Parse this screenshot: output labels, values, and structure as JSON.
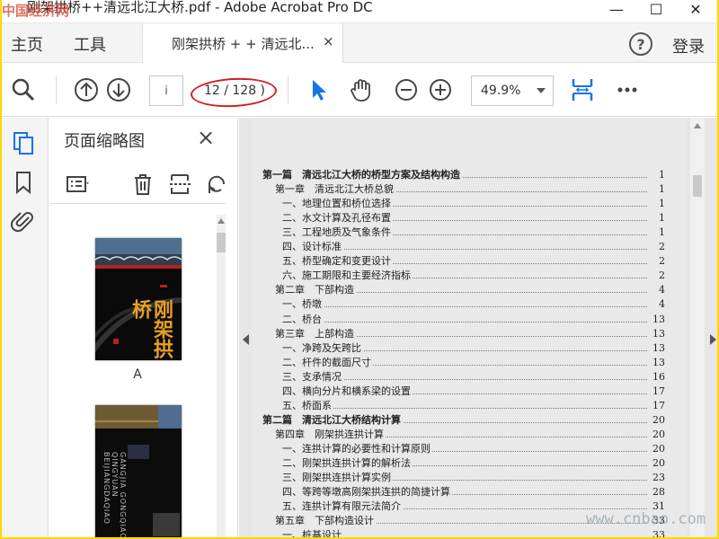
{
  "window": {
    "title": "刚架拱桥++清远北江大桥.pdf - Adobe Acrobat Pro DC",
    "watermark": "中国经济网"
  },
  "menu": {
    "home": "主页",
    "tools": "工具"
  },
  "tab": {
    "label": "刚架拱桥 + + 清远北...",
    "close": "×"
  },
  "header": {
    "help": "?",
    "login": "登录"
  },
  "toolbar": {
    "page_input_value": "i",
    "page_count": "12 / 128 )",
    "zoom_value": "49.9%"
  },
  "thumbnails": {
    "panel_title": "页面缩略图",
    "close": "×",
    "pages": [
      {
        "label": "A",
        "cover_text": "刚架拱桥"
      },
      {
        "label": "",
        "cover_text": "GANGJIA GONGQIAO QINGYUAN BEIJIANGDAQIAO"
      }
    ]
  },
  "toc": [
    {
      "level": 1,
      "text": "第一篇　清远北江大桥的桥型方案及结构构造",
      "page": "1"
    },
    {
      "level": 2,
      "text": "第一章　清远北江大桥总貌",
      "page": "1"
    },
    {
      "level": 3,
      "text": "一、地理位置和桥位选择",
      "page": "1"
    },
    {
      "level": 3,
      "text": "二、水文计算及孔径布置",
      "page": "1"
    },
    {
      "level": 3,
      "text": "三、工程地质及气象条件",
      "page": "1"
    },
    {
      "level": 3,
      "text": "四、设计标准",
      "page": "2"
    },
    {
      "level": 3,
      "text": "五、桥型确定和变更设计",
      "page": "2"
    },
    {
      "level": 3,
      "text": "六、施工期限和主要经济指标",
      "page": "2"
    },
    {
      "level": 2,
      "text": "第二章　下部构造",
      "page": "4"
    },
    {
      "level": 3,
      "text": "一、桥墩",
      "page": "4"
    },
    {
      "level": 3,
      "text": "二、桥台",
      "page": "13"
    },
    {
      "level": 2,
      "text": "第三章　上部构造",
      "page": "13"
    },
    {
      "level": 3,
      "text": "一、净跨及矢跨比",
      "page": "13"
    },
    {
      "level": 3,
      "text": "二、杆件的截面尺寸",
      "page": "13"
    },
    {
      "level": 3,
      "text": "三、支承情况",
      "page": "16"
    },
    {
      "level": 3,
      "text": "四、横向分片和横系梁的设置",
      "page": "17"
    },
    {
      "level": 3,
      "text": "五、桥面系",
      "page": "17"
    },
    {
      "level": 1,
      "text": "第二篇　清远北江大桥结构计算",
      "page": "20"
    },
    {
      "level": 2,
      "text": "第四章　刚架拱连拱计算",
      "page": "20"
    },
    {
      "level": 3,
      "text": "一、连拱计算的必要性和计算原则",
      "page": "20"
    },
    {
      "level": 3,
      "text": "二、刚架拱连拱计算的解析法",
      "page": "20"
    },
    {
      "level": 3,
      "text": "三、刚架拱连拱计算实例",
      "page": "23"
    },
    {
      "level": 3,
      "text": "四、等跨等墩高刚架拱连拱的简捷计算",
      "page": "28"
    },
    {
      "level": 3,
      "text": "五、连拱计算有限元法简介",
      "page": "31"
    },
    {
      "level": 2,
      "text": "第五章　下部构造设计",
      "page": "33"
    },
    {
      "level": 3,
      "text": "一、桩基设计",
      "page": "33"
    }
  ],
  "site_watermark": "www.cnbao.com",
  "colors": {
    "accent_blue": "#1473e6",
    "highlight_red": "#d0201e"
  }
}
